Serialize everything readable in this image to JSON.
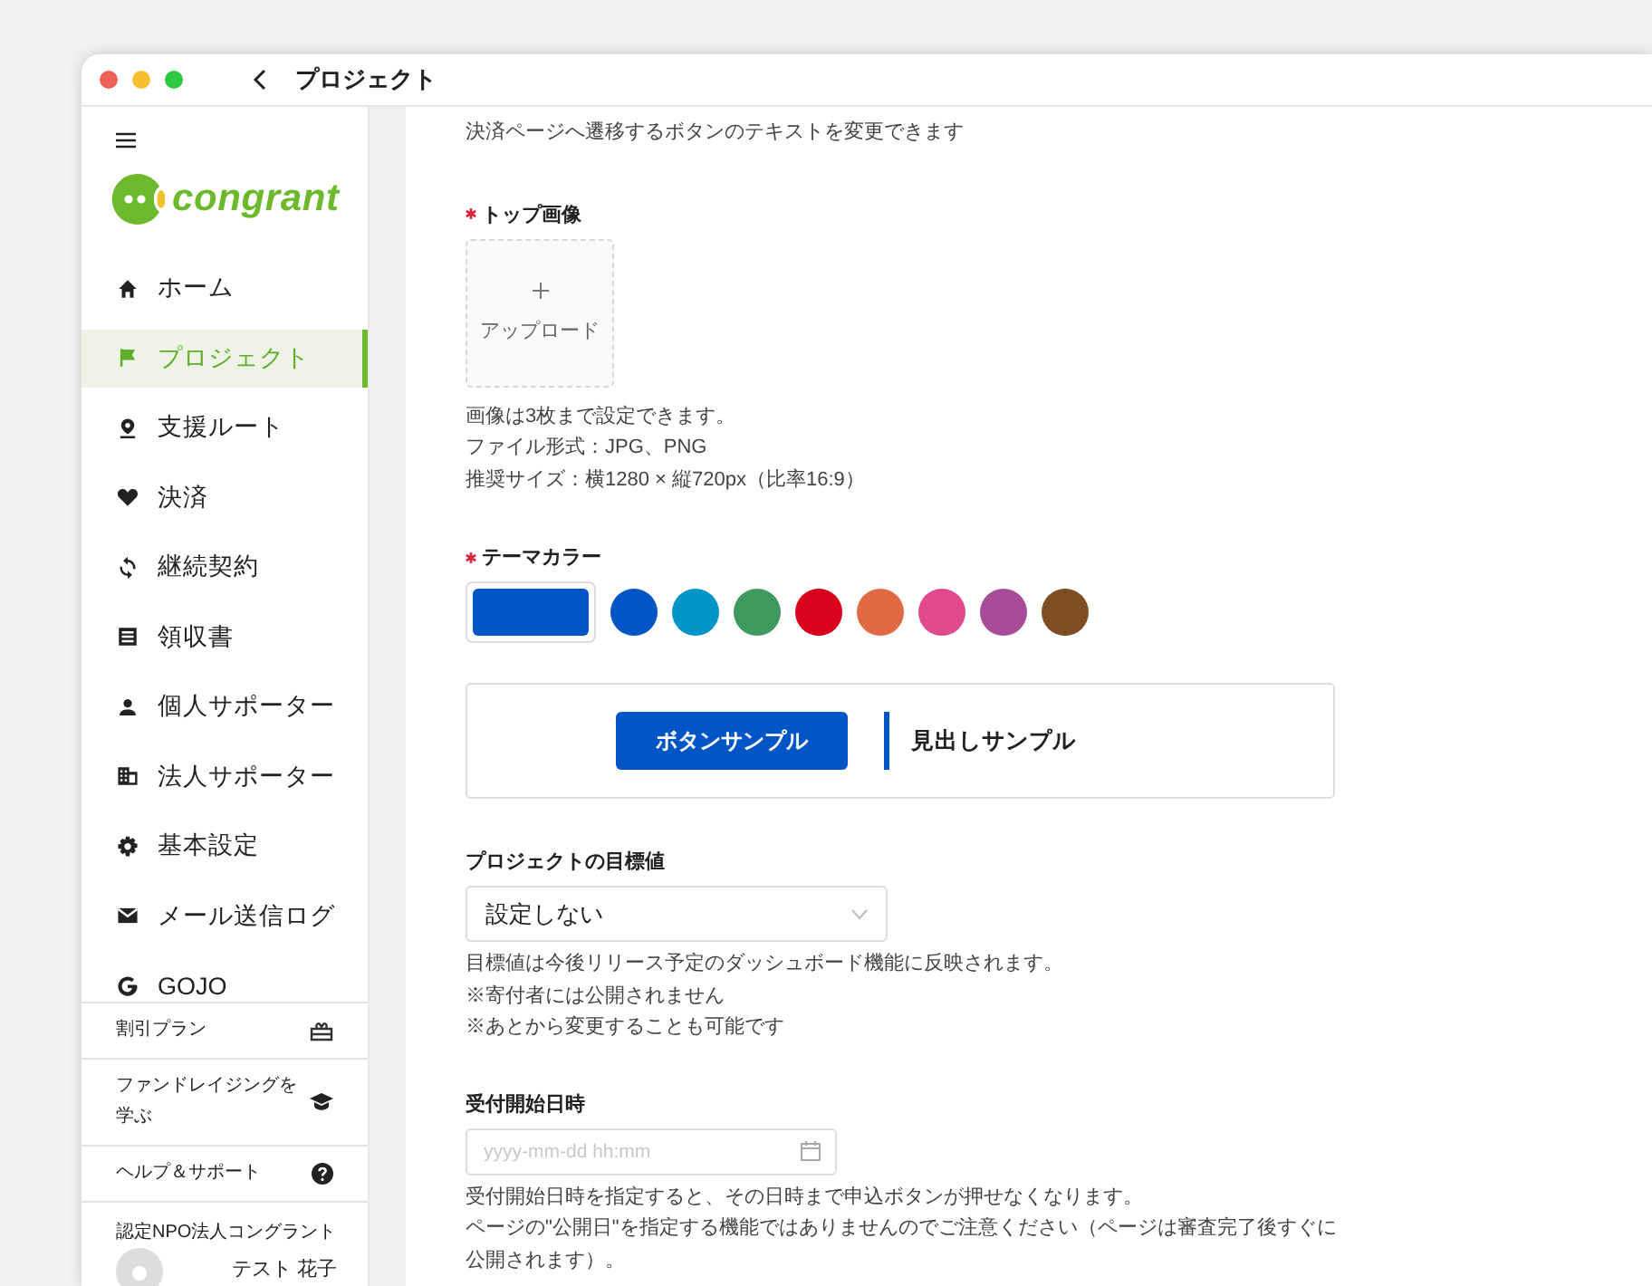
{
  "window": {
    "title": "プロジェクト"
  },
  "sidebar": {
    "logo": "congrant",
    "nav": [
      {
        "label": "ホーム",
        "selected": false
      },
      {
        "label": "プロジェクト",
        "selected": true
      },
      {
        "label": "支援ルート",
        "selected": false
      },
      {
        "label": "決済",
        "selected": false
      },
      {
        "label": "継続契約",
        "selected": false
      },
      {
        "label": "領収書",
        "selected": false
      },
      {
        "label": "個人サポーター",
        "selected": false
      },
      {
        "label": "法人サポーター",
        "selected": false
      },
      {
        "label": "基本設定",
        "selected": false
      },
      {
        "label": "メール送信ログ",
        "selected": false
      },
      {
        "label": "GOJO",
        "selected": false
      }
    ],
    "links": [
      {
        "label": "割引プラン"
      },
      {
        "label": "ファンドレイジングを学ぶ"
      },
      {
        "label": "ヘルプ＆サポート"
      }
    ],
    "organization": "認定NPO法人コングラント",
    "user": "テスト 花子"
  },
  "form": {
    "intro": "決済ページへ遷移するボタンのテキストを変更できます",
    "top_image": {
      "label": "トップ画像",
      "required": true,
      "upload": "アップロード",
      "notes": [
        "画像は3枚まで設定できます。",
        "ファイル形式：JPG、PNG",
        "推奨サイズ：横1280 × 縦720px（比率16:9）"
      ]
    },
    "theme_color": {
      "label": "テーマカラー",
      "required": true,
      "current": {
        "color": "#0055c6"
      },
      "swatches": [
        {
          "color": "#0055c6"
        },
        {
          "color": "#0095c8"
        },
        {
          "color": "#3f9a5f"
        },
        {
          "color": "#d8001c"
        },
        {
          "color": "#e06944"
        },
        {
          "color": "#e04a8b"
        },
        {
          "color": "#a64c99"
        },
        {
          "color": "#7c4e22"
        }
      ]
    },
    "preview": {
      "button": "ボタンサンプル",
      "heading": "見出しサンプル"
    },
    "goal": {
      "label": "プロジェクトの目標値",
      "value": "設定しない",
      "notes": [
        "目標値は今後リリース予定のダッシュボード機能に反映されます。",
        "※寄付者には公開されません",
        "※あとから変更することも可能です"
      ]
    },
    "start_date": {
      "label": "受付開始日時",
      "placeholder": "yyyy-mm-dd hh:mm",
      "notes": [
        "受付開始日時を指定すると、その日時まで申込ボタンが押せなくなります。",
        "ページの\"公開日\"を指定する機能ではありませんのでご注意ください（ページは審査完了後すぐに公開されます）。"
      ]
    }
  }
}
